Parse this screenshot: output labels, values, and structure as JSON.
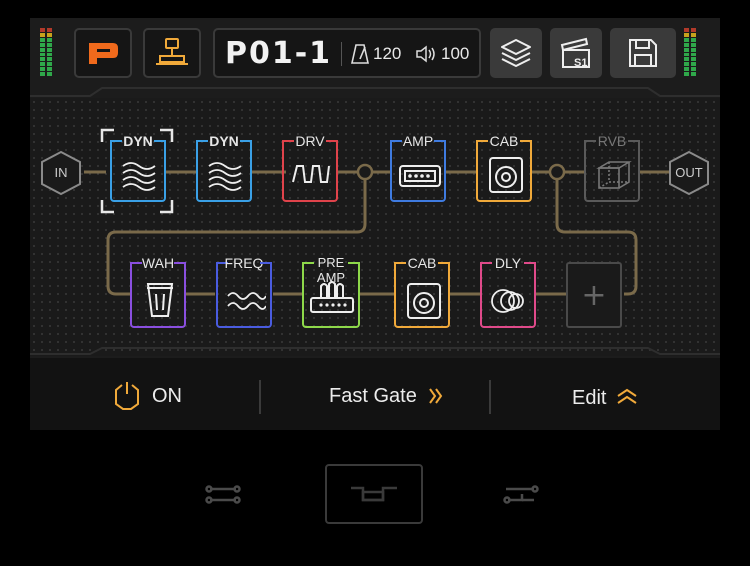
{
  "preset": {
    "name": "P01-1",
    "tempo": "120",
    "volume": "100"
  },
  "top_buttons": {
    "logo": "P",
    "scene": "S1"
  },
  "chain": {
    "input_label": "IN",
    "output_label": "OUT",
    "row1": [
      {
        "label": "DYN",
        "color": "#3aa0e6",
        "icon": "waves-icon",
        "selected": true
      },
      {
        "label": "DYN",
        "color": "#3aa0e6",
        "icon": "waves-icon"
      },
      {
        "label": "DRV",
        "color": "#e0434b",
        "icon": "square-wave-icon"
      },
      {
        "label": "AMP",
        "color": "#3f7be0",
        "icon": "amp-icon"
      },
      {
        "label": "CAB",
        "color": "#f0a93a",
        "icon": "speaker-icon"
      },
      {
        "label": "RVB",
        "color": "#5a5a5a",
        "icon": "cube-icon",
        "bypassed": true
      }
    ],
    "row2": [
      {
        "label": "WAH",
        "color": "#8a4fe0",
        "icon": "wah-icon"
      },
      {
        "label": "FREQ",
        "color": "#4a5ce0",
        "icon": "freq-icon"
      },
      {
        "label": "PRE AMP",
        "color": "#8ed84a",
        "icon": "preamp-icon"
      },
      {
        "label": "CAB",
        "color": "#f0a93a",
        "icon": "speaker-icon"
      },
      {
        "label": "DLY",
        "color": "#e04a8a",
        "icon": "delay-icon"
      }
    ],
    "add_label": "+"
  },
  "bottom": {
    "power_label": "ON",
    "block_name": "Fast Gate",
    "edit_label": "Edit"
  },
  "colors": {
    "accent": "#f0a93a",
    "logo": "#f06a1c",
    "path": "#7a6a4a"
  }
}
